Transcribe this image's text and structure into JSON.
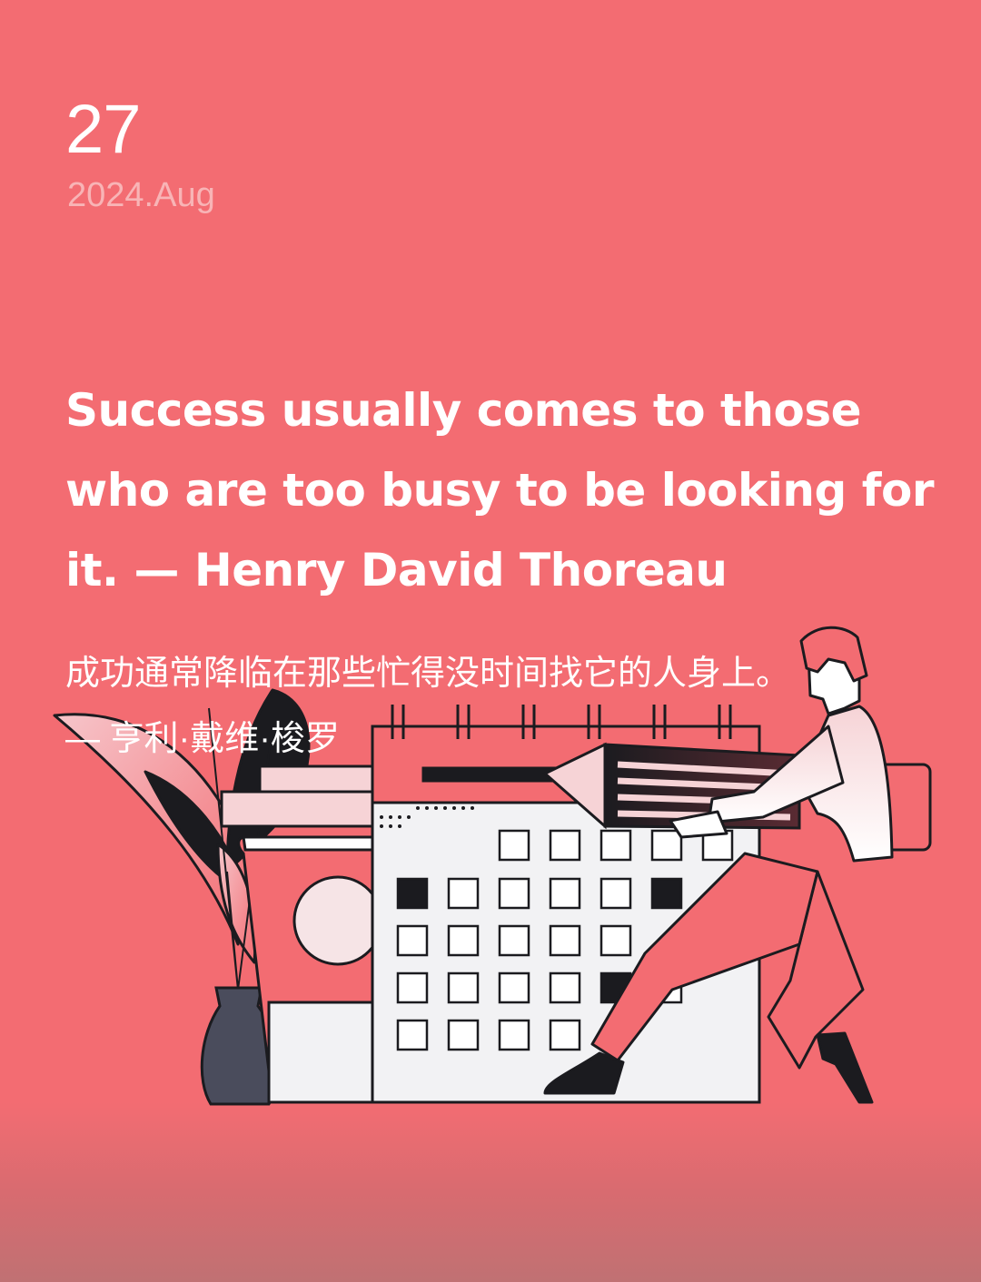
{
  "date": {
    "day": "27",
    "month": "2024.Aug"
  },
  "quote": {
    "english": "Success usually comes to those who are too busy to be looking for it. — Henry David Thoreau",
    "chinese_line1": "成功通常降临在那些忙得没时间找它的人身上。",
    "chinese_line2": "— 亨利·戴维·梭罗"
  },
  "illustration": {
    "name": "man-carrying-pencil-calendar"
  },
  "colors": {
    "background": "#f36c72",
    "text": "#ffffff",
    "month_text": "#f8b4b6",
    "ink": "#1b1b1f",
    "paper": "#f2f2f4",
    "vase": "#4a4c5c"
  }
}
